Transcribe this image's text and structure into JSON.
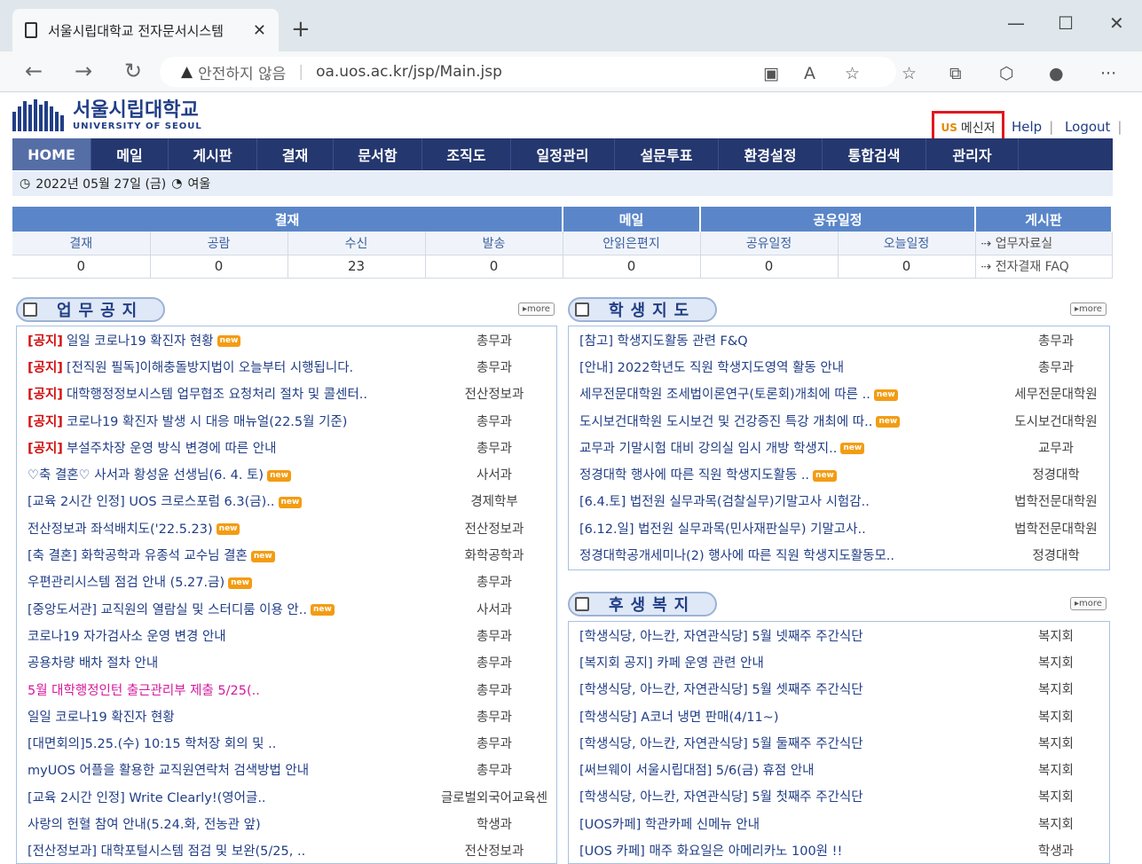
{
  "browser": {
    "tab_title": "서울시립대학교 전자문서시스템",
    "security_label": "안전하지 않음",
    "url": "oa.uos.ac.kr/jsp/Main.jsp"
  },
  "site": {
    "name_ko": "서울시립대학교",
    "name_en": "UNIVERSITY OF SEOUL",
    "messenger_label": "메신저",
    "help": "Help",
    "logout": "Logout"
  },
  "menu": [
    "HOME",
    "메일",
    "게시판",
    "결재",
    "문서함",
    "조직도",
    "일정관리",
    "설문투표",
    "환경설정",
    "통합검색",
    "관리자"
  ],
  "date": "2022년 05월 27일 (금)",
  "status": "여울",
  "summary": {
    "groups": [
      "결재",
      "메일",
      "공유일정",
      "게시판"
    ],
    "labels": [
      "결재",
      "공람",
      "수신",
      "발송",
      "안읽은편지",
      "공유일정",
      "오늘일정"
    ],
    "values": [
      "0",
      "0",
      "23",
      "0",
      "0",
      "0",
      "0"
    ],
    "board_links": [
      "업무자료실",
      "전자결재 FAQ"
    ]
  },
  "more_label": "more",
  "notice": {
    "title": "업무공지",
    "items": [
      {
        "tag": "[공지]",
        "title": "일일 코로나19 확진자 현황",
        "dept": "총무과",
        "new": true
      },
      {
        "tag": "[공지]",
        "title": "[전직원 필독]이해충돌방지법이 오늘부터 시행됩니다.",
        "dept": "총무과",
        "new": false
      },
      {
        "tag": "[공지]",
        "title": "대학행정정보시스템 업무협조 요청처리 절차 및 콜센터..",
        "dept": "전산정보과",
        "new": false
      },
      {
        "tag": "[공지]",
        "title": "코로나19 확진자 발생 시 대응 매뉴얼(22.5월 기준)",
        "dept": "총무과",
        "new": false
      },
      {
        "tag": "[공지]",
        "title": "부설주차장 운영 방식 변경에 따른 안내",
        "dept": "총무과",
        "new": false
      },
      {
        "tag": "",
        "title": "♡축 결혼♡ 사서과 황성윤 선생님(6. 4. 토)",
        "dept": "사서과",
        "new": true
      },
      {
        "tag": "",
        "title": "[교육 2시간 인정] UOS 크로스포럼 6.3(금)..",
        "dept": "경제학부",
        "new": true
      },
      {
        "tag": "",
        "title": "전산정보과 좌석배치도('22.5.23)",
        "dept": "전산정보과",
        "new": true
      },
      {
        "tag": "",
        "title": "[축 결혼] 화학공학과 유종석 교수님 결혼",
        "dept": "화학공학과",
        "new": true
      },
      {
        "tag": "",
        "title": "우편관리시스템 점검 안내 (5.27.금)",
        "dept": "총무과",
        "new": true
      },
      {
        "tag": "",
        "title": "[중앙도서관] 교직원의 열람실 및 스터디룸 이용 안..",
        "dept": "사서과",
        "new": true
      },
      {
        "tag": "",
        "title": "코로나19 자가검사소 운영 변경 안내",
        "dept": "총무과",
        "new": false
      },
      {
        "tag": "",
        "title": "공용차량 배차 절차 안내",
        "dept": "총무과",
        "new": false
      },
      {
        "tag": "",
        "title": "5월 대학행정인턴 출근관리부 제출 5/25(..",
        "dept": "총무과",
        "new": false,
        "pink": true
      },
      {
        "tag": "",
        "title": "일일 코로나19 확진자 현황",
        "dept": "총무과",
        "new": false
      },
      {
        "tag": "",
        "title": "[대면회의]5.25.(수) 10:15 학처장 회의 및 ..",
        "dept": "총무과",
        "new": false
      },
      {
        "tag": "",
        "title": "myUOS 어플을 활용한 교직원연락처 검색방법 안내",
        "dept": "총무과",
        "new": false
      },
      {
        "tag": "",
        "title": "[교육 2시간 인정] Write Clearly!(영어글..",
        "dept": "글로벌외국어교육센",
        "new": false
      },
      {
        "tag": "",
        "title": "사랑의 헌혈 참여 안내(5.24.화, 전농관 앞)",
        "dept": "학생과",
        "new": false
      },
      {
        "tag": "",
        "title": "[전산정보과] 대학포털시스템 점검 및 보완(5/25, ..",
        "dept": "전산정보과",
        "new": false
      }
    ]
  },
  "guidance": {
    "title": "학생지도",
    "items": [
      {
        "title": "[참고] 학생지도활동 관련 F&Q",
        "dept": "총무과",
        "new": false
      },
      {
        "title": "[안내] 2022학년도 직원 학생지도영역 활동 안내",
        "dept": "총무과",
        "new": false
      },
      {
        "title": "세무전문대학원 조세법이론연구(토론회)개최에 따른 ..",
        "dept": "세무전문대학원",
        "new": true
      },
      {
        "title": "도시보건대학원 도시보건 및 건강증진 특강 개최에 따..",
        "dept": "도시보건대학원",
        "new": true
      },
      {
        "title": "교무과 기말시험 대비 강의실 임시 개방 학생지..",
        "dept": "교무과",
        "new": true
      },
      {
        "title": "정경대학 행사에 따른 직원 학생지도활동 ..",
        "dept": "정경대학",
        "new": true
      },
      {
        "title": "[6.4.토] 법전원 실무과목(검찰실무)기말고사 시험감..",
        "dept": "법학전문대학원",
        "new": false
      },
      {
        "title": "[6.12.일] 법전원 실무과목(민사재판실무) 기말고사..",
        "dept": "법학전문대학원",
        "new": false
      },
      {
        "title": "정경대학공개세미나(2) 행사에 따른 직원 학생지도활동모..",
        "dept": "정경대학",
        "new": false
      }
    ]
  },
  "welfare": {
    "title": "후생복지",
    "items": [
      {
        "title": "[학생식당, 아느칸, 자연관식당] 5월 넷째주 주간식단",
        "dept": "복지회",
        "new": false
      },
      {
        "title": "[복지회 공지] 카페 운영 관련 안내",
        "dept": "복지회",
        "new": false
      },
      {
        "title": "[학생식당, 아느칸, 자연관식당] 5월 셋째주 주간식단",
        "dept": "복지회",
        "new": false
      },
      {
        "title": "[학생식당] A코너 냉면 판매(4/11~)",
        "dept": "복지회",
        "new": false
      },
      {
        "title": "[학생식당, 아느칸, 자연관식당] 5월 둘째주 주간식단",
        "dept": "복지회",
        "new": false
      },
      {
        "title": "[써브웨이 서울시립대점] 5/6(금) 휴점 안내",
        "dept": "복지회",
        "new": false
      },
      {
        "title": "[학생식당, 아느칸, 자연관식당] 5월 첫째주 주간식단",
        "dept": "복지회",
        "new": false
      },
      {
        "title": "[UOS카페] 학관카페 신메뉴 안내",
        "dept": "복지회",
        "new": false
      },
      {
        "title": "[UOS 카페] 매주 화요일은 아메리카노 100원 !!",
        "dept": "학생과",
        "new": false
      }
    ]
  }
}
